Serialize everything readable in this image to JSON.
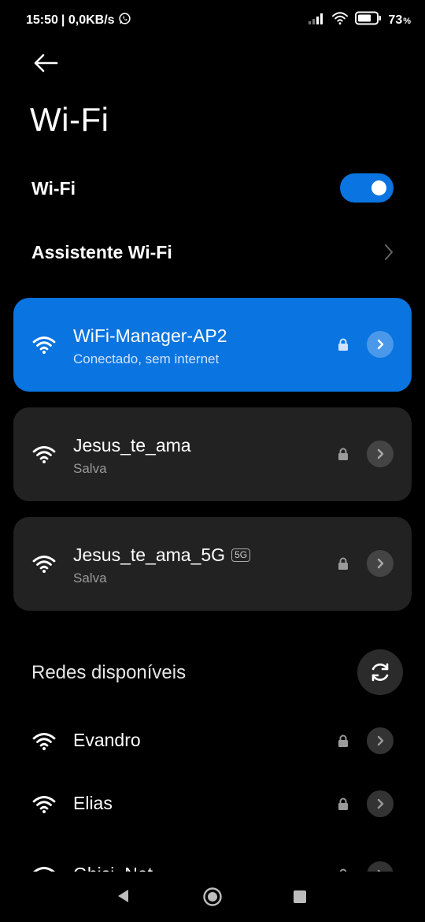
{
  "status_bar": {
    "time": "15:50",
    "speed": "| 0,0KB/s",
    "battery_percent": "73",
    "battery_unit": "%",
    "battery_level": 0.73
  },
  "header": {
    "back_icon": "arrow-left-icon",
    "title": "Wi-Fi"
  },
  "wifi_toggle": {
    "label": "Wi-Fi",
    "enabled": true
  },
  "assistant": {
    "label": "Assistente Wi-Fi"
  },
  "saved_networks": [
    {
      "ssid": "WiFi-Manager-AP2",
      "status": "Conectado, sem internet",
      "secured": true,
      "connected": true,
      "badge": ""
    },
    {
      "ssid": "Jesus_te_ama",
      "status": "Salva",
      "secured": true,
      "connected": false,
      "badge": ""
    },
    {
      "ssid": "Jesus_te_ama_5G",
      "status": "Salva",
      "secured": true,
      "connected": false,
      "badge": "5G"
    }
  ],
  "available": {
    "title": "Redes disponíveis",
    "networks": [
      {
        "ssid": "Evandro",
        "secured": true
      },
      {
        "ssid": "Elias",
        "secured": true
      },
      {
        "ssid": "Ghisi_Net",
        "secured": true
      }
    ]
  },
  "colors": {
    "accent": "#0a74e0",
    "card": "#222222",
    "background": "#000000"
  }
}
